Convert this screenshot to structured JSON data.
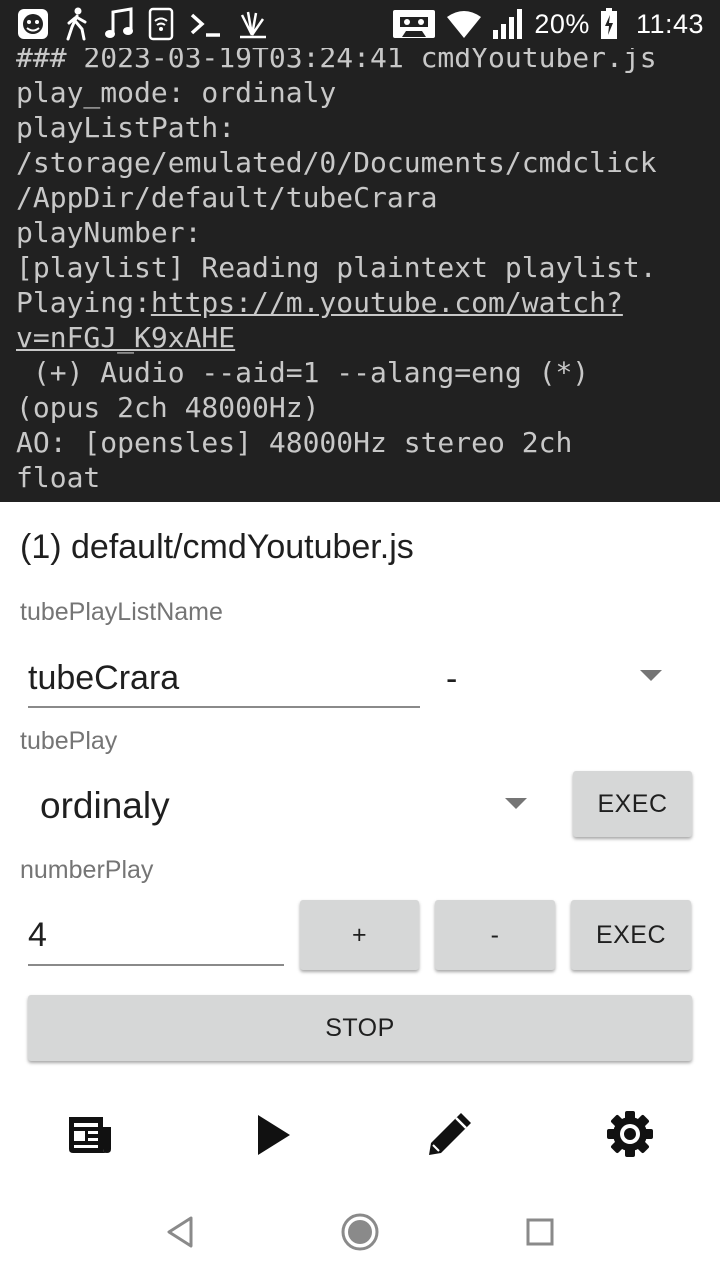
{
  "status_bar": {
    "icons_left": [
      "app-face-icon",
      "walking-person-icon",
      "music-note-icon",
      "cast-wifi-icon",
      "terminal-prompt-icon",
      "fan-icon"
    ],
    "icons_right": [
      "cassette-icon",
      "wifi-icon",
      "signal-icon",
      "battery-charging-icon"
    ],
    "battery_percent": "20%",
    "time": "11:43"
  },
  "terminal": {
    "lines": [
      {
        "text": "### 2023-03-19T03:24:41 cmdYoutuber.js"
      },
      {
        "text": "play_mode: ordinaly"
      },
      {
        "text": "playListPath:"
      },
      {
        "text": "/storage/emulated/0/Documents/cmdclick"
      },
      {
        "text": "/AppDir/default/tubeCrara"
      },
      {
        "text": "playNumber:"
      },
      {
        "text": "[playlist] Reading plaintext playlist."
      },
      {
        "prefix": "Playing:",
        "link": "https://m.youtube.com/watch?"
      },
      {
        "link": "v=nFGJ_K9xAHE"
      },
      {
        "text": " (+) Audio --aid=1 --alang=eng (*)"
      },
      {
        "text": "(opus 2ch 48000Hz)"
      },
      {
        "text": "AO: [opensles] 48000Hz stereo 2ch"
      },
      {
        "text": "float"
      }
    ]
  },
  "form": {
    "title": "(1) default/cmdYoutuber.js",
    "playlist_name": {
      "label": "tubePlayListName",
      "value": "tubeCrara",
      "spinner_value": "-"
    },
    "tube_play": {
      "label": "tubePlay",
      "spinner_value": "ordinaly",
      "exec_label": "EXEC"
    },
    "number_play": {
      "label": "numberPlay",
      "value": "4",
      "plus_label": "+",
      "minus_label": "-",
      "exec_label": "EXEC"
    },
    "stop_label": "STOP"
  },
  "toolbar": {
    "icons": [
      "newspaper-icon",
      "play-icon",
      "pencil-icon",
      "gear-icon"
    ]
  },
  "nav_bar": {
    "icons": [
      "back-icon",
      "home-icon",
      "recents-icon"
    ]
  },
  "colors": {
    "status_bar_bg": "#212121",
    "terminal_bg": "#212121",
    "terminal_text": "#c8c8c8",
    "button_bg": "#d6d7d7",
    "label_gray": "#757575"
  }
}
